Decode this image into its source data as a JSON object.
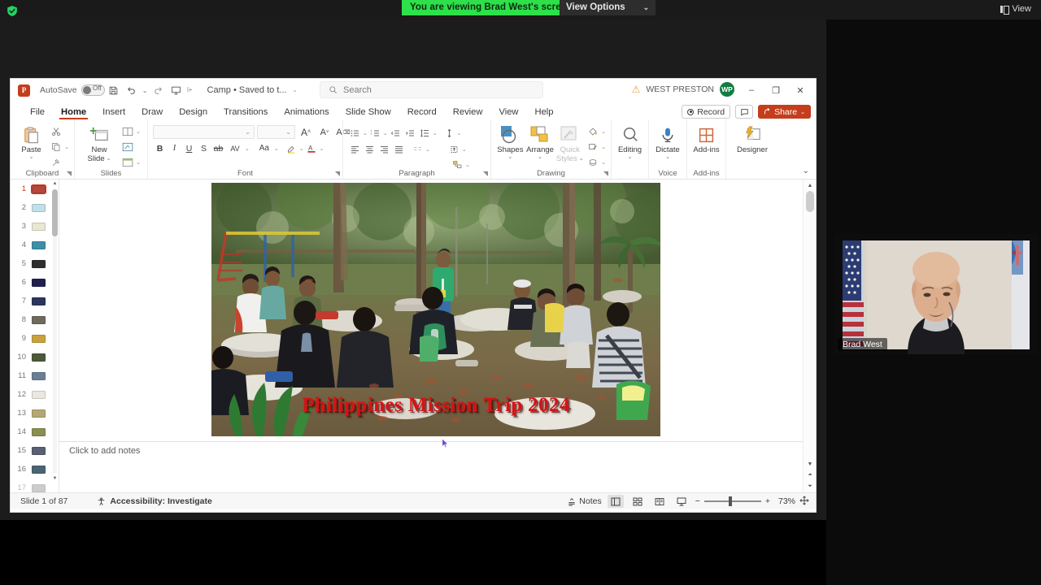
{
  "zoom_bar": {
    "shield_icon": "shield-check-icon",
    "sharing_banner": "You are viewing Brad West's screen",
    "view_options_label": "View Options",
    "view_options_caret": "⌄",
    "view_button_label": "View"
  },
  "powerpoint": {
    "titlebar": {
      "app_logo": "P",
      "autosave_label": "AutoSave",
      "autosave_state": "Off",
      "save_icon": "save-icon",
      "undo_icon": "undo-icon",
      "redo_icon": "redo-icon",
      "present_icon": "start-presentation-icon",
      "customize_icon": "customize-toolbar-icon",
      "document_name": "Camp  •  Saved to t...",
      "doc_caret": "⌄",
      "search_placeholder": "Search",
      "search_icon": "search-icon",
      "warning_icon": "warning-triangle-icon",
      "account_name": "WEST PRESTON",
      "account_initials": "WP",
      "minimize": "–",
      "restore": "❐",
      "close": "✕"
    },
    "tabs": [
      {
        "label": "File",
        "active": false
      },
      {
        "label": "Home",
        "active": true
      },
      {
        "label": "Insert",
        "active": false
      },
      {
        "label": "Draw",
        "active": false
      },
      {
        "label": "Design",
        "active": false
      },
      {
        "label": "Transitions",
        "active": false
      },
      {
        "label": "Animations",
        "active": false
      },
      {
        "label": "Slide Show",
        "active": false
      },
      {
        "label": "Record",
        "active": false
      },
      {
        "label": "Review",
        "active": false
      },
      {
        "label": "View",
        "active": false
      },
      {
        "label": "Help",
        "active": false
      }
    ],
    "tab_right": {
      "record_label": "Record",
      "comment_icon": "comment-icon",
      "share_label": "Share",
      "share_caret": "⌄"
    },
    "ribbon": {
      "groups": [
        {
          "name": "Clipboard",
          "title": "Clipboard"
        },
        {
          "name": "Slides",
          "title": "Slides"
        },
        {
          "name": "Font",
          "title": "Font"
        },
        {
          "name": "Paragraph",
          "title": "Paragraph"
        },
        {
          "name": "Drawing",
          "title": "Drawing"
        },
        {
          "name": "Voice",
          "title": "Voice"
        },
        {
          "name": "Add-ins",
          "title": "Add-ins"
        }
      ],
      "paste_label": "Paste",
      "paste_caret": "⌄",
      "cut_icon": "scissors-icon",
      "copy_icon": "copy-icon",
      "format_painter_icon": "format-painter-icon",
      "new_slide_label": "New\nSlide",
      "new_slide_line1": "New",
      "new_slide_line2": "Slide",
      "layout_icon": "slide-layout-icon",
      "reset_icon": "reset-slide-icon",
      "section_icon": "section-icon",
      "font_name_value": "",
      "font_size_value": "",
      "grow_font": "A",
      "shrink_font": "A",
      "clear_format": "A",
      "bold": "B",
      "italic": "I",
      "underline": "U",
      "shadow": "S",
      "strikethrough": "ab",
      "char_spacing": "AV",
      "change_case": "Aa",
      "text_highlight_icon": "highlight-icon",
      "font_color_icon": "font-color-icon",
      "bullets_icon": "bullet-list-icon",
      "numbering_icon": "numbered-list-icon",
      "decrease_indent_icon": "decrease-indent-icon",
      "increase_indent_icon": "increase-indent-icon",
      "line_spacing_icon": "line-spacing-icon",
      "align_left_icon": "align-left-icon",
      "align_center_icon": "align-center-icon",
      "align_right_icon": "align-right-icon",
      "justify_icon": "justify-icon",
      "columns_icon": "columns-icon",
      "text_direction_icon": "text-direction-icon",
      "align_text_icon": "align-text-icon",
      "convert_smartart_icon": "convert-to-smartart-icon",
      "shapes_label": "Shapes",
      "arrange_label": "Arrange",
      "quick_styles_label_1": "Quick",
      "quick_styles_label_2": "Styles",
      "shape_fill_icon": "shape-fill-icon",
      "shape_outline_icon": "shape-outline-icon",
      "shape_effects_icon": "shape-effects-icon",
      "editing_label": "Editing",
      "dictate_label": "Dictate",
      "addins_label": "Add-ins",
      "designer_label": "Designer",
      "collapse_caret": "⌄"
    },
    "thumbnails": {
      "selected": 1,
      "slides": [
        {
          "n": "1",
          "color": "#b8463a"
        },
        {
          "n": "2",
          "color": "#bfe0ea"
        },
        {
          "n": "3",
          "color": "#e9e6d2"
        },
        {
          "n": "4",
          "color": "#3d8fa8"
        },
        {
          "n": "5",
          "color": "#2f2f2f"
        },
        {
          "n": "6",
          "color": "#1f2050"
        },
        {
          "n": "7",
          "color": "#2b3560"
        },
        {
          "n": "8",
          "color": "#6e6a5c"
        },
        {
          "n": "9",
          "color": "#c9a23b"
        },
        {
          "n": "10",
          "color": "#4d5a3a"
        },
        {
          "n": "11",
          "color": "#6c7f95"
        },
        {
          "n": "12",
          "color": "#ebe8e0"
        },
        {
          "n": "13",
          "color": "#b3a874"
        },
        {
          "n": "14",
          "color": "#8a8f4f"
        },
        {
          "n": "15",
          "color": "#5a5f72"
        },
        {
          "n": "16",
          "color": "#4a6473"
        },
        {
          "n": "17",
          "color": "#9b9b9b"
        }
      ]
    },
    "slide": {
      "title_text": "Philippines Mission Trip 2024",
      "title_color": "#d41414",
      "notes_placeholder": "Click to add notes",
      "photo_description": "Outdoor youth group seated at stone picnic tables under trees in a park"
    },
    "statusbar": {
      "slide_counter": "Slide 1 of 87",
      "accessibility_icon": "accessibility-icon",
      "accessibility_label": "Accessibility: Investigate",
      "notes_label": "Notes",
      "view_normal_icon": "normal-view-icon",
      "view_sorter_icon": "slide-sorter-icon",
      "view_reading_icon": "reading-view-icon",
      "view_slideshow_icon": "slideshow-icon",
      "zoom_out": "−",
      "zoom_in": "+",
      "zoom_level": "73%",
      "fit_slide_icon": "fit-to-window-icon"
    }
  },
  "video": {
    "participant_name": "Brad West"
  }
}
